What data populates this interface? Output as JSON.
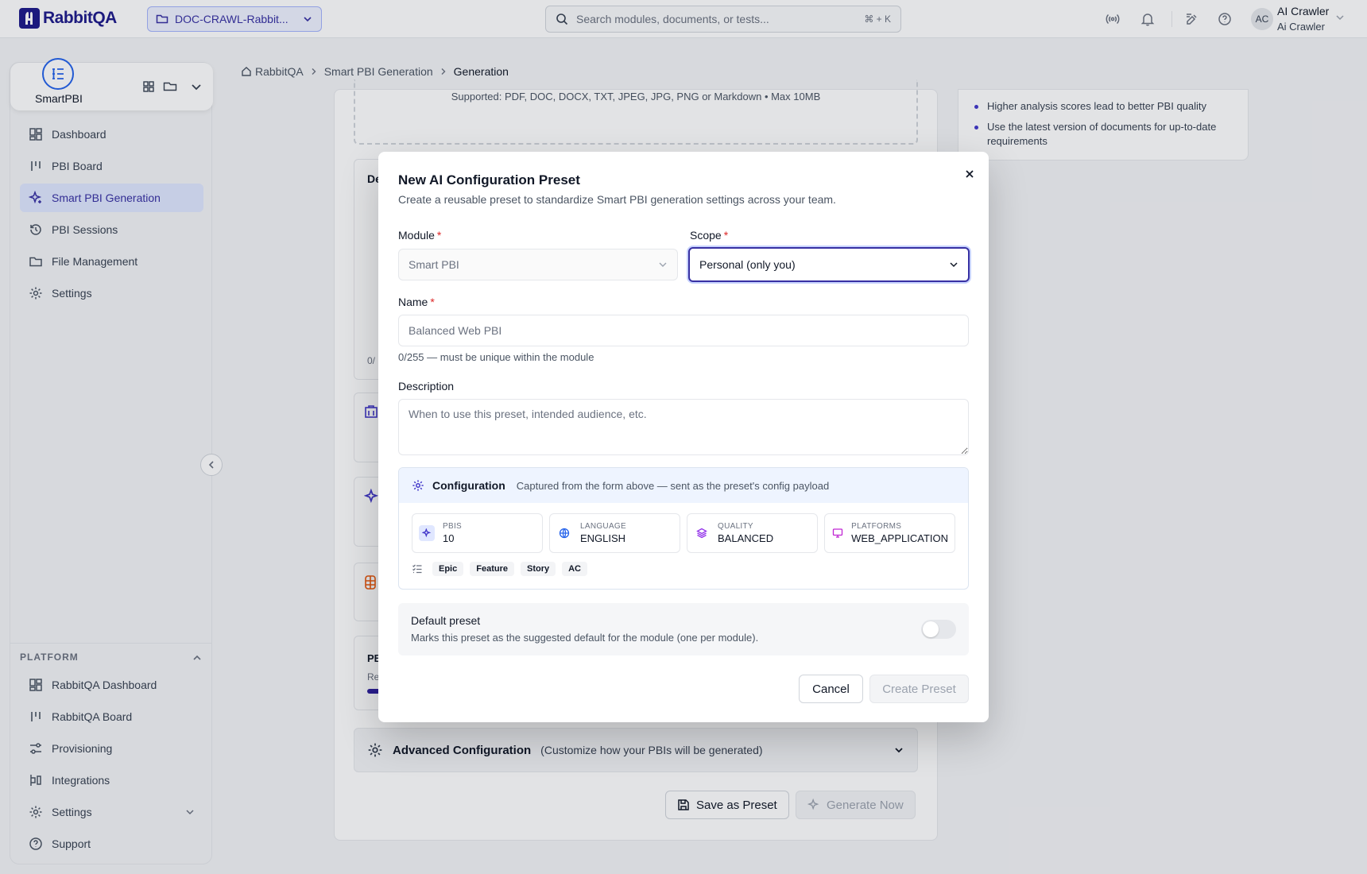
{
  "topbar": {
    "logo_text": "RabbitQA",
    "project": "DOC-CRAWL-Rabbit...",
    "search_placeholder": "Search modules, documents, or tests...",
    "search_shortcut": "⌘ + K",
    "user_initials": "AC",
    "user_name": "AI Crawler",
    "user_sub": "Ai Crawler"
  },
  "sidebar": {
    "app_name": "SmartPBI",
    "items": [
      {
        "label": "Dashboard",
        "icon": "dashboard-icon"
      },
      {
        "label": "PBI Board",
        "icon": "board-icon"
      },
      {
        "label": "Smart PBI Generation",
        "icon": "sparkle-icon",
        "active": true
      },
      {
        "label": "PBI Sessions",
        "icon": "history-icon"
      },
      {
        "label": "File Management",
        "icon": "folder-icon"
      },
      {
        "label": "Settings",
        "icon": "gear-icon"
      }
    ],
    "platform_label": "PLATFORM",
    "platform_items": [
      {
        "label": "RabbitQA Dashboard",
        "icon": "dashboard-icon"
      },
      {
        "label": "RabbitQA Board",
        "icon": "board-icon"
      },
      {
        "label": "Provisioning",
        "icon": "sliders-icon"
      },
      {
        "label": "Integrations",
        "icon": "integrations-icon"
      },
      {
        "label": "Settings",
        "icon": "gear-icon"
      },
      {
        "label": "Support",
        "icon": "help-icon"
      }
    ]
  },
  "breadcrumb": {
    "home": "RabbitQA",
    "parent": "Smart PBI Generation",
    "current": "Generation"
  },
  "background": {
    "dropzone_supported": "Supported: PDF, DOC, DOCX, TXT, JPEG, JPG, PNG or Markdown • Max 10MB",
    "tips": [
      "Higher analysis scores lead to better PBI quality",
      "Use the latest version of documents for up-to-date requirements"
    ],
    "advanced_title": "Advanced Configuration",
    "advanced_sub": "(Customize how your PBIs will be generated)",
    "save_preset": "Save as Preset",
    "generate_now": "Generate Now",
    "fragments": {
      "de": "De",
      "zero": "0/",
      "pb": "PB",
      "re": "Re"
    }
  },
  "modal": {
    "title": "New AI Configuration Preset",
    "subtitle": "Create a reusable preset to standardize Smart PBI generation settings across your team.",
    "module_label": "Module",
    "module_value": "Smart PBI",
    "scope_label": "Scope",
    "scope_value": "Personal (only you)",
    "required_mark": "*",
    "name_label": "Name",
    "name_placeholder": "Balanced Web PBI",
    "name_hint": "0/255 — must be unique within the module",
    "description_label": "Description",
    "description_placeholder": "When to use this preset, intended audience, etc.",
    "config_title": "Configuration",
    "config_desc": "Captured from the form above — sent as the preset's config payload",
    "stats": [
      {
        "label": "PBIS",
        "value": "10",
        "icon": "sparkle-icon",
        "color": "#4338ca",
        "bg": "#e0e7ff"
      },
      {
        "label": "LANGUAGE",
        "value": "ENGLISH",
        "icon": "globe-icon",
        "color": "#2563eb",
        "bg": "#ffffff"
      },
      {
        "label": "QUALITY",
        "value": "BALANCED",
        "icon": "layers-icon",
        "color": "#9333ea",
        "bg": "#ffffff"
      },
      {
        "label": "PLATFORMS",
        "value": "WEB_APPLICATION",
        "icon": "monitor-icon",
        "color": "#c026d3",
        "bg": "#ffffff"
      }
    ],
    "tags": [
      "Epic",
      "Feature",
      "Story",
      "AC"
    ],
    "default_title": "Default preset",
    "default_desc": "Marks this preset as the suggested default for the module (one per module).",
    "default_on": false,
    "cancel": "Cancel",
    "create": "Create Preset"
  }
}
